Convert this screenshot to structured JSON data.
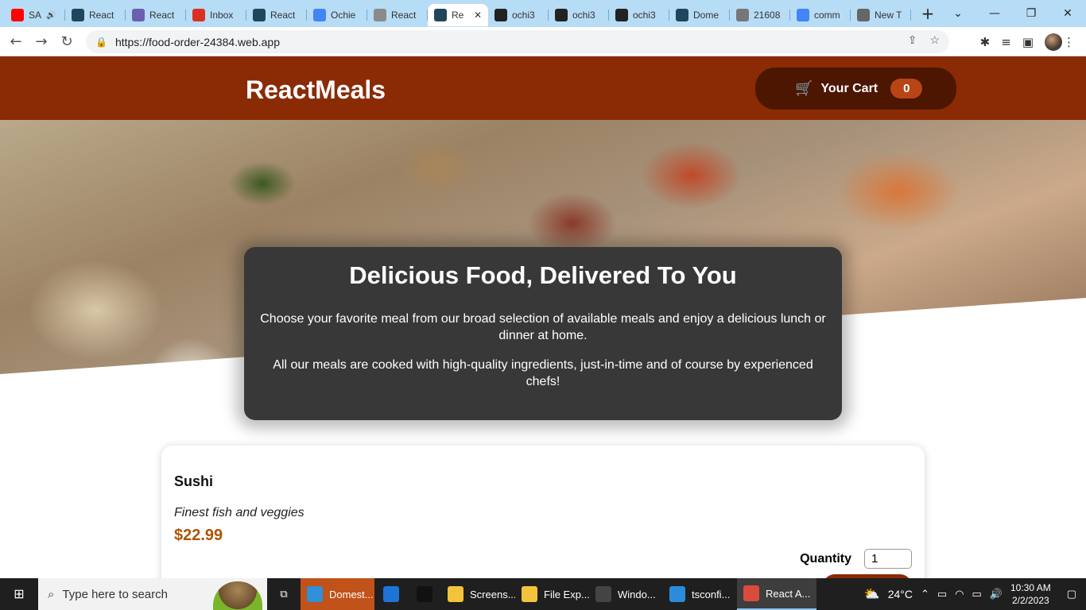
{
  "browser": {
    "tabs": [
      {
        "title": "SA",
        "icon": "youtube-icon",
        "color": "#ff0000",
        "audio": true
      },
      {
        "title": "React",
        "icon": "react-icon",
        "color": "#20465c"
      },
      {
        "title": "React",
        "icon": "react-app-icon",
        "color": "#6b5fb0"
      },
      {
        "title": "Inbox",
        "icon": "gmail-icon",
        "color": "#d93025"
      },
      {
        "title": "React",
        "icon": "react-icon",
        "color": "#20465c"
      },
      {
        "title": "Ochie",
        "icon": "docs-icon",
        "color": "#4285f4"
      },
      {
        "title": "React",
        "icon": "react-outline-icon",
        "color": "#8a8a8a"
      },
      {
        "title": "Re",
        "icon": "react-icon",
        "color": "#20465c",
        "active": true
      },
      {
        "title": "ochi3",
        "icon": "github-icon",
        "color": "#222222"
      },
      {
        "title": "ochi3",
        "icon": "github-icon",
        "color": "#222222"
      },
      {
        "title": "ochi3",
        "icon": "github-icon",
        "color": "#222222"
      },
      {
        "title": "Dome",
        "icon": "react-icon",
        "color": "#20465c"
      },
      {
        "title": "21608",
        "icon": "globe-icon",
        "color": "#777777"
      },
      {
        "title": "comm",
        "icon": "google-icon",
        "color": "#4285f4"
      },
      {
        "title": "New T",
        "icon": "chrome-icon",
        "color": "#666666"
      }
    ],
    "url": "https://food-order-24384.web.app"
  },
  "app": {
    "brand": "ReactMeals",
    "cart": {
      "label": "Your Cart",
      "count": "0"
    },
    "summary": {
      "title": "Delicious Food, Delivered To You",
      "p1": "Choose your favorite meal from our broad selection of available meals and enjoy a delicious lunch or dinner at home.",
      "p2": "All our meals are cooked with high-quality ingredients, just-in-time and of course by experienced chefs!"
    },
    "meal": {
      "name": "Sushi",
      "description": "Finest fish and veggies",
      "price": "$22.99",
      "quantity_label": "Quantity",
      "quantity_value": "1"
    }
  },
  "taskbar": {
    "search_placeholder": "Type here to search",
    "items": [
      {
        "label": "Domest...",
        "icon": "edge-icon",
        "color": "#2f8fd8",
        "style": "hl"
      },
      {
        "label": "",
        "icon": "mail-icon",
        "color": "#1e74d6",
        "style": "narrow"
      },
      {
        "label": "",
        "icon": "tiktok-icon",
        "color": "#111111",
        "style": "narrow"
      },
      {
        "label": "Screens...",
        "icon": "folder-icon",
        "color": "#f3c33c",
        "style": "wide"
      },
      {
        "label": "File Exp...",
        "icon": "file-explorer-icon",
        "color": "#f3c33c",
        "style": "wide"
      },
      {
        "label": "Windo...",
        "icon": "terminal-icon",
        "color": "#444444",
        "style": "wide"
      },
      {
        "label": "tsconfi...",
        "icon": "vscode-icon",
        "color": "#2a8cda",
        "style": "wide"
      },
      {
        "label": "React A...",
        "icon": "chrome-icon",
        "color": "#dc4a3d",
        "style": "active"
      }
    ],
    "weather": "24°C",
    "time": "10:30 AM",
    "date": "2/2/2023"
  }
}
